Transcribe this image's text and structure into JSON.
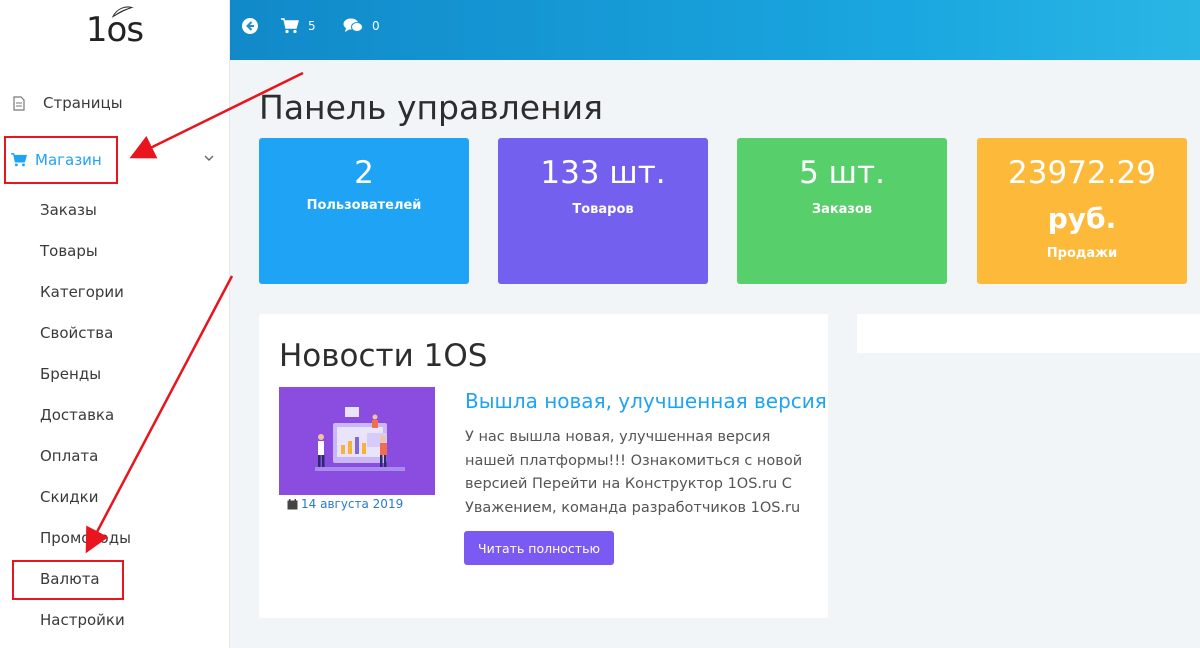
{
  "app": {
    "logo_text": "1os"
  },
  "sidebar": {
    "items": [
      {
        "label": "Страницы"
      },
      {
        "label": "Магазин"
      }
    ],
    "submenu": [
      "Заказы",
      "Товары",
      "Категории",
      "Свойства",
      "Бренды",
      "Доставка",
      "Оплата",
      "Скидки",
      "Промокоды",
      "Валюта",
      "Настройки"
    ]
  },
  "topbar": {
    "cart_count": "5",
    "messages_count": "0"
  },
  "main": {
    "title": "Панель управления",
    "stats": [
      {
        "value": "2",
        "label": "Пользователей",
        "color": "#1ea3f5"
      },
      {
        "value": "133 шт.",
        "label": "Товаров",
        "color": "#7360ee"
      },
      {
        "value": "5 шт.",
        "label": "Заказов",
        "color": "#57cf6b"
      },
      {
        "value_line1": "23972.29",
        "value_line2": "руб.",
        "label": "Продажи",
        "color": "#fdb93a"
      }
    ],
    "news": {
      "title": "Новости 1OS",
      "date": "14 августа 2019",
      "headline": "Вышла новая, улучшенная версия",
      "text": "У нас вышла новая, улучшенная версия нашей платформы!!! Ознакомиться с новой версией Перейти на Конструктор 1OS.ru С Уважением, команда разработчиков 1OS.ru",
      "button_label": "Читать полностью"
    }
  },
  "colors": {
    "accent": "#1ea3f5",
    "annotation": "#e8141e"
  }
}
